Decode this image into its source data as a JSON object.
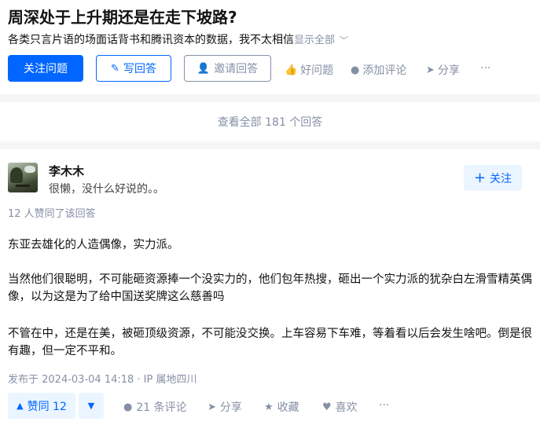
{
  "question": {
    "title": "周深处于上升期还是在走下坡路?",
    "description": "各类只言片语的场面话背书和腾讯资本的数据，我不太相信",
    "show_all": "显示全部",
    "follow_label": "关注问题",
    "write_label": "写回答",
    "invite_label": "邀请回答",
    "good_question_label": "好问题",
    "add_comment_label": "添加评论",
    "share_label": "分享",
    "more_label": "···"
  },
  "view_all": "查看全部 181 个回答",
  "answer": {
    "author": "李木木",
    "headline": "很懒，没什么好说的。。",
    "follow_label": "关注",
    "voters_text": "12 人赞同了该回答",
    "paragraphs": [
      "东亚去雄化的人造偶像，实力派。",
      "当然他们很聪明，不可能砸资源捧一个没实力的，他们包年热搜，砸出一个实力派的犹杂白左滑雪精英偶像，以为这是为了给中国送奖牌这么慈善吗",
      "不管在中，还是在美，被砸顶级资源，不可能没交换。上车容易下车难，等着看以后会发生啥吧。倒是很有趣，但一定不平和。"
    ],
    "meta": "发布于 2024-03-04 14:18 · IP 属地四川",
    "upvote_label": "赞同 12",
    "comments_label": "21 条评论",
    "share_label": "分享",
    "collect_label": "收藏",
    "like_label": "喜欢",
    "more_label": "···"
  },
  "colors": {
    "accent": "#0066ff",
    "muted": "#8590a6",
    "accent_bg": "#ebf5ff"
  },
  "icons": [
    "pencil-icon",
    "invite-user-icon",
    "thumb-up-icon",
    "comment-icon",
    "share-icon",
    "plus-icon",
    "triangle-up-icon",
    "triangle-down-icon",
    "star-icon",
    "heart-icon"
  ]
}
